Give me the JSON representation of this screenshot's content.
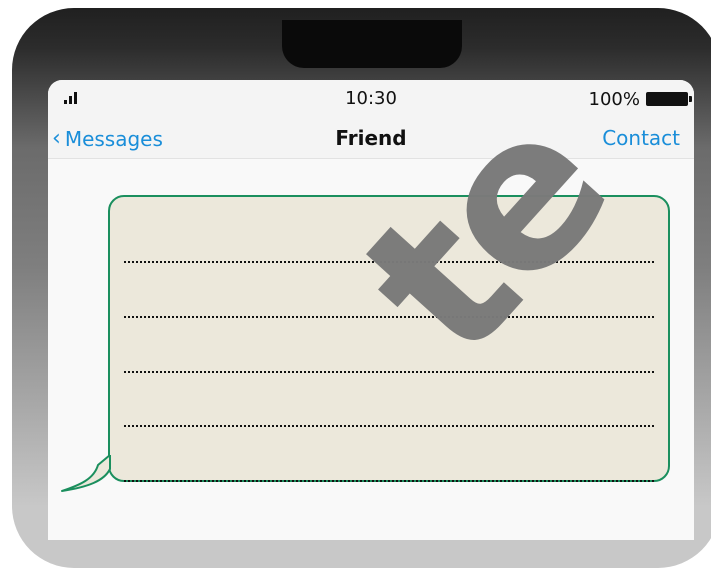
{
  "status_bar": {
    "time": "10:30",
    "battery_percent": "100%",
    "signal_icon": "cellular-signal-icon",
    "battery_icon": "battery-full-icon"
  },
  "nav_bar": {
    "back_chevron": "‹",
    "back_label": "Messages",
    "title": "Friend",
    "contact_label": "Contact"
  },
  "message": {
    "lines": [
      "",
      "",
      "",
      "",
      ""
    ]
  },
  "watermark": {
    "text": "te"
  },
  "colors": {
    "link": "#1a8ed9",
    "bubble_fill": "#ece8db",
    "bubble_border": "#1b8f5e",
    "watermark": "#7a7a7a"
  }
}
